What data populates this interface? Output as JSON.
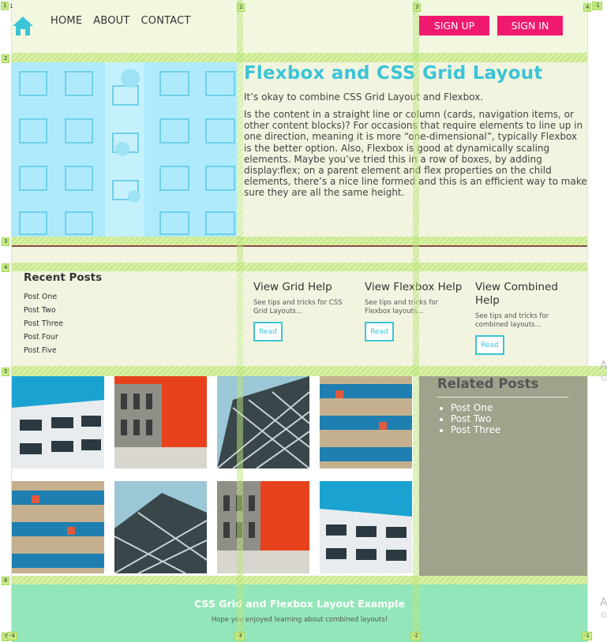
{
  "header": {
    "nav": [
      "HOME",
      "ABOUT",
      "CONTACT"
    ],
    "sign_up": "SIGN UP",
    "sign_in": "SIGN IN",
    "accent": "#ef1a6f"
  },
  "hero": {
    "title": "Flexbox and CSS Grid Layout",
    "p1": "It’s okay to combine CSS Grid Layout and Flexbox.",
    "p2": "Is the content in a straight line or column (cards, navigation items, or other content blocks)? For occasions that require elements to line up in one direction, meaning it is more “one-dimensional”, typically Flexbox is the better option. Also, Flexbox is good at dynamically scaling elements. Maybe you’ve tried this in a row of boxes, by adding display:flex; on a parent element and flex properties on the child elements, there’s a nice line formed and this is an efficient way to make sure they are all the same height.",
    "accent": "#3bc4d6"
  },
  "recent": {
    "title": "Recent Posts",
    "items": [
      "Post One",
      "Post Two",
      "Post Three",
      "Post Four",
      "Post Five"
    ]
  },
  "cards": [
    {
      "title": "View Grid Help",
      "text": "See tips and tricks for CSS Grid Layouts...",
      "button": "Read"
    },
    {
      "title": "View Flexbox Help",
      "text": "See tips and tricks for Flexbox layouts...",
      "button": "Read"
    },
    {
      "title": "View Combined Help",
      "text": "See tips and tricks for combined layouts...",
      "button": "Read"
    }
  ],
  "related": {
    "title": "Related Posts",
    "items": [
      "Post One",
      "Post Two",
      "Post Three"
    ]
  },
  "footer": {
    "title": "CSS Grid and Flexbox Layout Example",
    "subtitle": "Hope you enjoyed learning about combined layouts!"
  },
  "grid_overlay": {
    "top_numbers": [
      "1",
      "2",
      "3",
      "4",
      "-1"
    ],
    "row_numbers": [
      "1",
      "2",
      "3",
      "4",
      "5",
      "6",
      "7"
    ],
    "bottom_numbers": [
      "-4",
      "-3",
      "-2",
      "-1"
    ]
  },
  "offscreen": [
    "A",
    "G",
    "A",
    "G"
  ]
}
